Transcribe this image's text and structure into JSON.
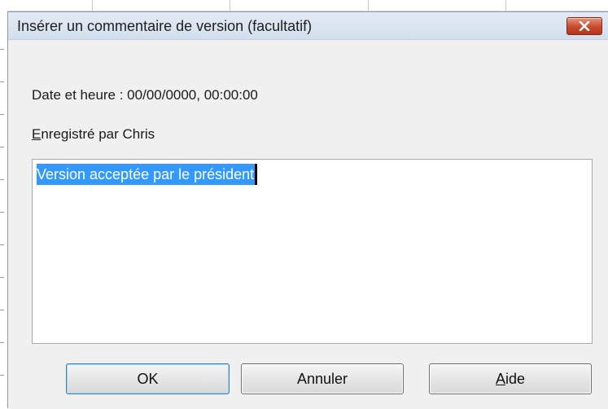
{
  "dialog": {
    "title": "Insérer un commentaire de version (facultatif)",
    "close_icon": "close-x-icon",
    "date_label": "Date et heure : 00/00/0000, 00:00:00",
    "saved_by_mnemonic": "E",
    "saved_by_rest": "nregistré par Chris",
    "comment_value": "Version acceptée par le président",
    "buttons": {
      "ok": "OK",
      "cancel": "Annuler",
      "help_mnemonic": "A",
      "help_rest": "ide"
    },
    "colors": {
      "selection": "#3399ff",
      "close_button": "#c74a2c",
      "dialog_bg": "#f0f0f0"
    }
  }
}
